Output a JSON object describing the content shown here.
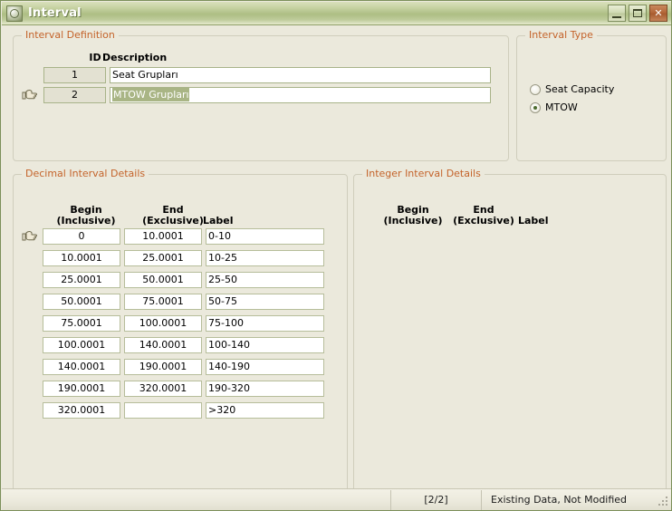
{
  "window": {
    "title": "Interval",
    "icon": "app-globe-icon",
    "buttons": {
      "minimize": "minimize-button",
      "maximize": "maximize-button",
      "close": "close-button"
    }
  },
  "interval_definition": {
    "legend": "Interval Definition",
    "headers": {
      "id": "ID",
      "description": "Description"
    },
    "rows": [
      {
        "id": "1",
        "description": "Seat Grupları",
        "selected": false,
        "current": false
      },
      {
        "id": "2",
        "description": "MTOW Grupları",
        "selected": true,
        "current": true
      }
    ]
  },
  "interval_type": {
    "legend": "Interval Type",
    "options": [
      {
        "label": "Seat Capacity",
        "checked": false
      },
      {
        "label": "MTOW",
        "checked": true
      }
    ]
  },
  "decimal_interval_details": {
    "legend": "Decimal Interval Details",
    "headers": {
      "begin_line1": "Begin",
      "begin_line2": "(Inclusive)",
      "end_line1": "End",
      "end_line2": "(Exclusive)",
      "label": "Label"
    },
    "rows": [
      {
        "begin": "0",
        "end": "10.0001",
        "label": "0-10",
        "current": true
      },
      {
        "begin": "10.0001",
        "end": "25.0001",
        "label": "10-25",
        "current": false
      },
      {
        "begin": "25.0001",
        "end": "50.0001",
        "label": "25-50",
        "current": false
      },
      {
        "begin": "50.0001",
        "end": "75.0001",
        "label": "50-75",
        "current": false
      },
      {
        "begin": "75.0001",
        "end": "100.0001",
        "label": "75-100",
        "current": false
      },
      {
        "begin": "100.0001",
        "end": "140.0001",
        "label": "100-140",
        "current": false
      },
      {
        "begin": "140.0001",
        "end": "190.0001",
        "label": "140-190",
        "current": false
      },
      {
        "begin": "190.0001",
        "end": "320.0001",
        "label": "190-320",
        "current": false
      },
      {
        "begin": "320.0001",
        "end": "",
        "label": ">320",
        "current": false
      }
    ]
  },
  "integer_interval_details": {
    "legend": "Integer Interval Details",
    "headers": {
      "begin_line1": "Begin",
      "begin_line2": "(Inclusive)",
      "end_line1": "End",
      "end_line2": "(Exclusive)",
      "label": "Label"
    },
    "rows": []
  },
  "statusbar": {
    "left": "",
    "record_count": "[2/2]",
    "status": "Existing Data, Not Modified"
  },
  "colors": {
    "titlebar_green": "#adbe84",
    "legend_orange": "#c4632a",
    "surface": "#ebe9dc",
    "field_border": "#b6bd9a",
    "selection": "#a9b585",
    "close_red": "#b4673a"
  }
}
